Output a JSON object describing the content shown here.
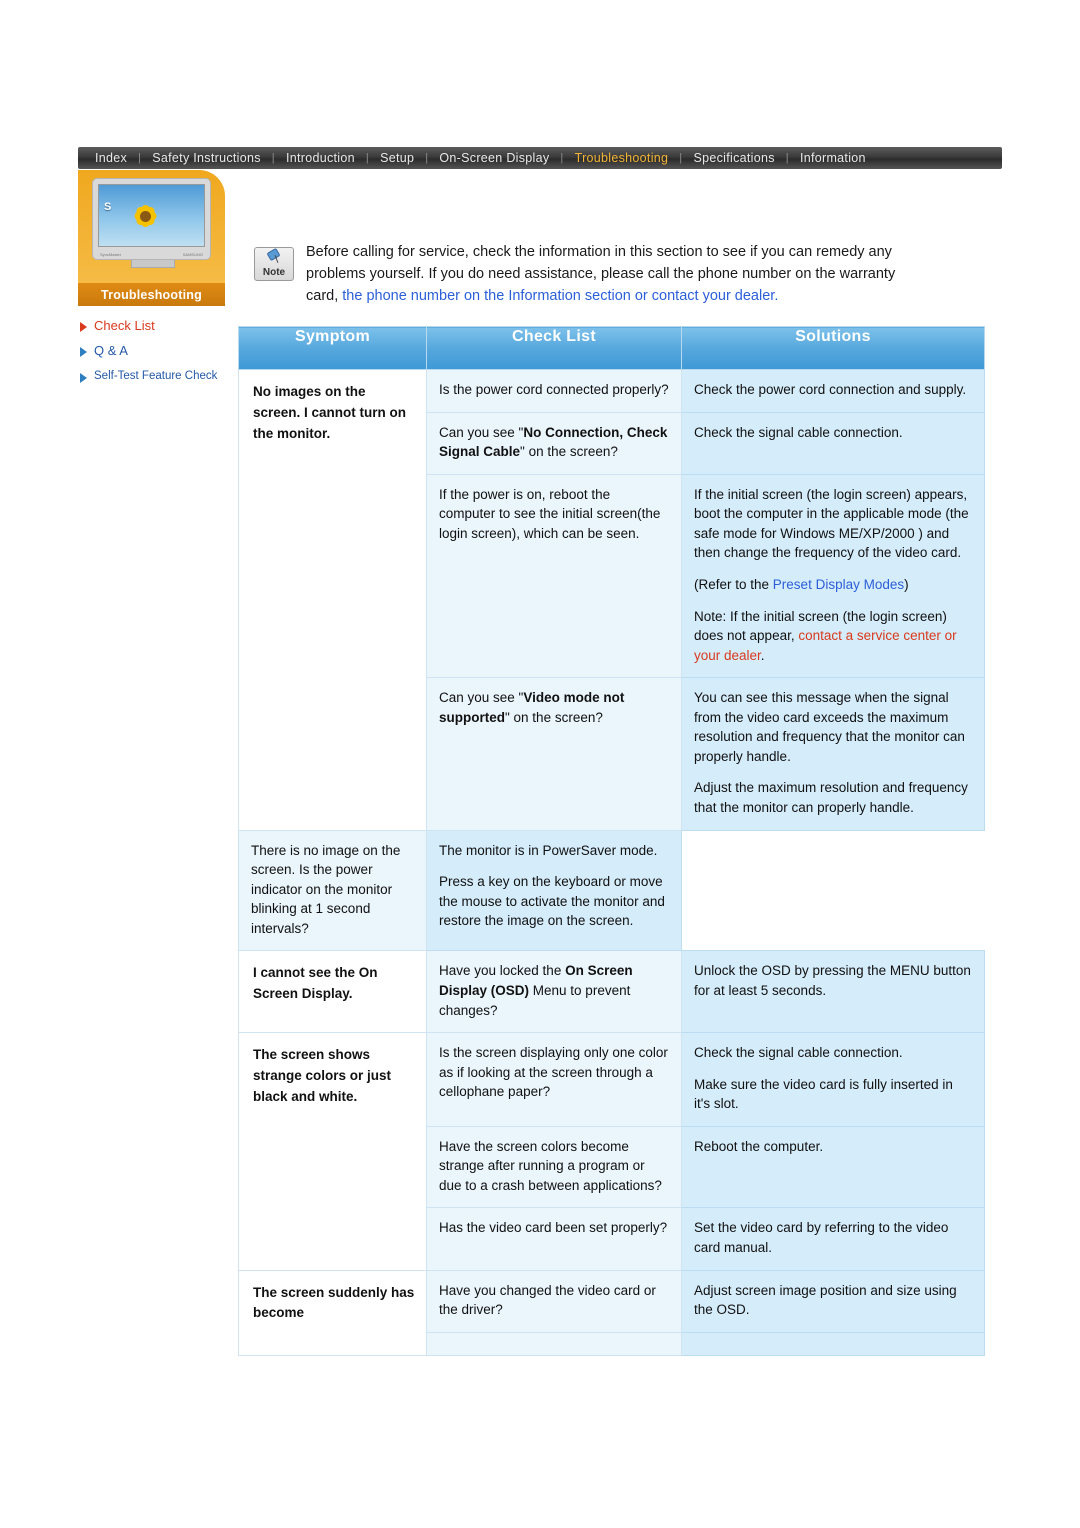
{
  "nav": {
    "items": [
      {
        "label": "Index",
        "active": false
      },
      {
        "label": "Safety Instructions",
        "active": false
      },
      {
        "label": "Introduction",
        "active": false
      },
      {
        "label": "Setup",
        "active": false
      },
      {
        "label": "On-Screen Display",
        "active": false
      },
      {
        "label": "Troubleshooting",
        "active": true
      },
      {
        "label": "Specifications",
        "active": false
      },
      {
        "label": "Information",
        "active": false
      }
    ],
    "separator": "|"
  },
  "sidebar": {
    "section_label": "Troubleshooting",
    "monitor_letter": "S",
    "monitor_label_left": "SyncMaster",
    "monitor_label_right": "SAMSUNG",
    "items": [
      {
        "label": "Check List",
        "active": true
      },
      {
        "label": "Q & A",
        "active": false
      },
      {
        "label": "Self-Test Feature Check",
        "active": false
      }
    ]
  },
  "note": {
    "icon_label": "Note",
    "line1": "Before calling for service, check the information in this section to see if you can remedy any",
    "line2": "problems yourself. If you do need assistance, please call the phone number on the warranty",
    "line3_plain": "card, ",
    "line3_link": "the phone number on the Information section or contact your dealer."
  },
  "table": {
    "headers": [
      "Symptom",
      "Check List",
      "Solutions"
    ],
    "rows": [
      {
        "symptom": "No images on the screen. I cannot turn on the monitor.",
        "symptom_rowspan": 4,
        "check_parts": [
          {
            "text": "Is the power cord connected properly?"
          }
        ],
        "solution_parts": [
          {
            "text": "Check the power cord connection and supply."
          }
        ]
      },
      {
        "check_parts": [
          {
            "text": "Can you see \""
          },
          {
            "text": "No Connection, Check Signal Cable",
            "bold": true
          },
          {
            "text": "\" on the screen?"
          }
        ],
        "solution_parts": [
          {
            "text": "Check the signal cable connection."
          }
        ]
      },
      {
        "check_parts": [
          {
            "text": "If the power is on, reboot the computer to see the initial screen(the login screen), which can be seen."
          }
        ],
        "solution_parts": [
          {
            "text": "If the initial screen (the login screen) appears, boot the computer in the applicable mode (the safe mode for Windows ME/XP/2000 ) and then change the frequency of the video card."
          },
          {
            "gap": true
          },
          {
            "text": "(Refer to the "
          },
          {
            "text": "Preset Display Modes",
            "link": "blue"
          },
          {
            "text": ")"
          },
          {
            "gap": true
          },
          {
            "text": "Note: If the initial screen (the login screen) does not appear, "
          },
          {
            "text": "contact a service center or your dealer",
            "link": "red"
          },
          {
            "text": "."
          }
        ]
      },
      {
        "check_parts": [
          {
            "text": "Can you see \""
          },
          {
            "text": "Video mode not supported",
            "bold": true
          },
          {
            "text": "\" on the screen?"
          }
        ],
        "solution_parts": [
          {
            "text": "You can see this message when the signal from the video card exceeds the maximum resolution and frequency that the monitor can properly handle."
          },
          {
            "gap": true
          },
          {
            "text": "Adjust the maximum resolution and frequency that the monitor can properly handle."
          }
        ]
      },
      {
        "check_parts": [
          {
            "text": "There is no image on the screen. Is the power indicator on the monitor blinking at 1 second intervals?"
          }
        ],
        "solution_parts": [
          {
            "text": "The monitor is in PowerSaver mode."
          },
          {
            "gap": true
          },
          {
            "text": "Press a key on the keyboard or move the mouse to activate the monitor and restore the image on the screen."
          }
        ]
      },
      {
        "symptom": "I cannot see the On Screen Display.",
        "symptom_rowspan": 1,
        "check_parts": [
          {
            "text": "Have you locked the "
          },
          {
            "text": "On Screen Display (OSD)",
            "bold": true
          },
          {
            "text": " Menu to prevent changes?"
          }
        ],
        "solution_parts": [
          {
            "text": "Unlock the OSD by pressing the MENU button for at least 5 seconds."
          }
        ]
      },
      {
        "symptom": "The screen shows strange colors or just black and white.",
        "symptom_rowspan": 3,
        "check_parts": [
          {
            "text": "Is the screen displaying only one color as if looking at the screen through a cellophane paper?"
          }
        ],
        "solution_parts": [
          {
            "text": "Check the signal cable connection."
          },
          {
            "gap": true
          },
          {
            "text": "Make sure the video card is fully inserted in it's slot."
          }
        ]
      },
      {
        "check_parts": [
          {
            "text": "Have the screen colors become strange after running a program or due to a crash between applications?"
          }
        ],
        "solution_parts": [
          {
            "text": "Reboot the computer."
          }
        ]
      },
      {
        "check_parts": [
          {
            "text": "Has the video card been set properly?"
          }
        ],
        "solution_parts": [
          {
            "text": "Set the video card by referring to the video card manual."
          }
        ]
      },
      {
        "symptom": "The screen suddenly has become",
        "symptom_rowspan": 2,
        "check_parts": [
          {
            "text": "Have you changed the video card or the driver?"
          }
        ],
        "solution_parts": [
          {
            "text": "Adjust screen image position and size using the OSD."
          }
        ]
      },
      {
        "check_parts": [],
        "solution_parts": []
      }
    ]
  }
}
